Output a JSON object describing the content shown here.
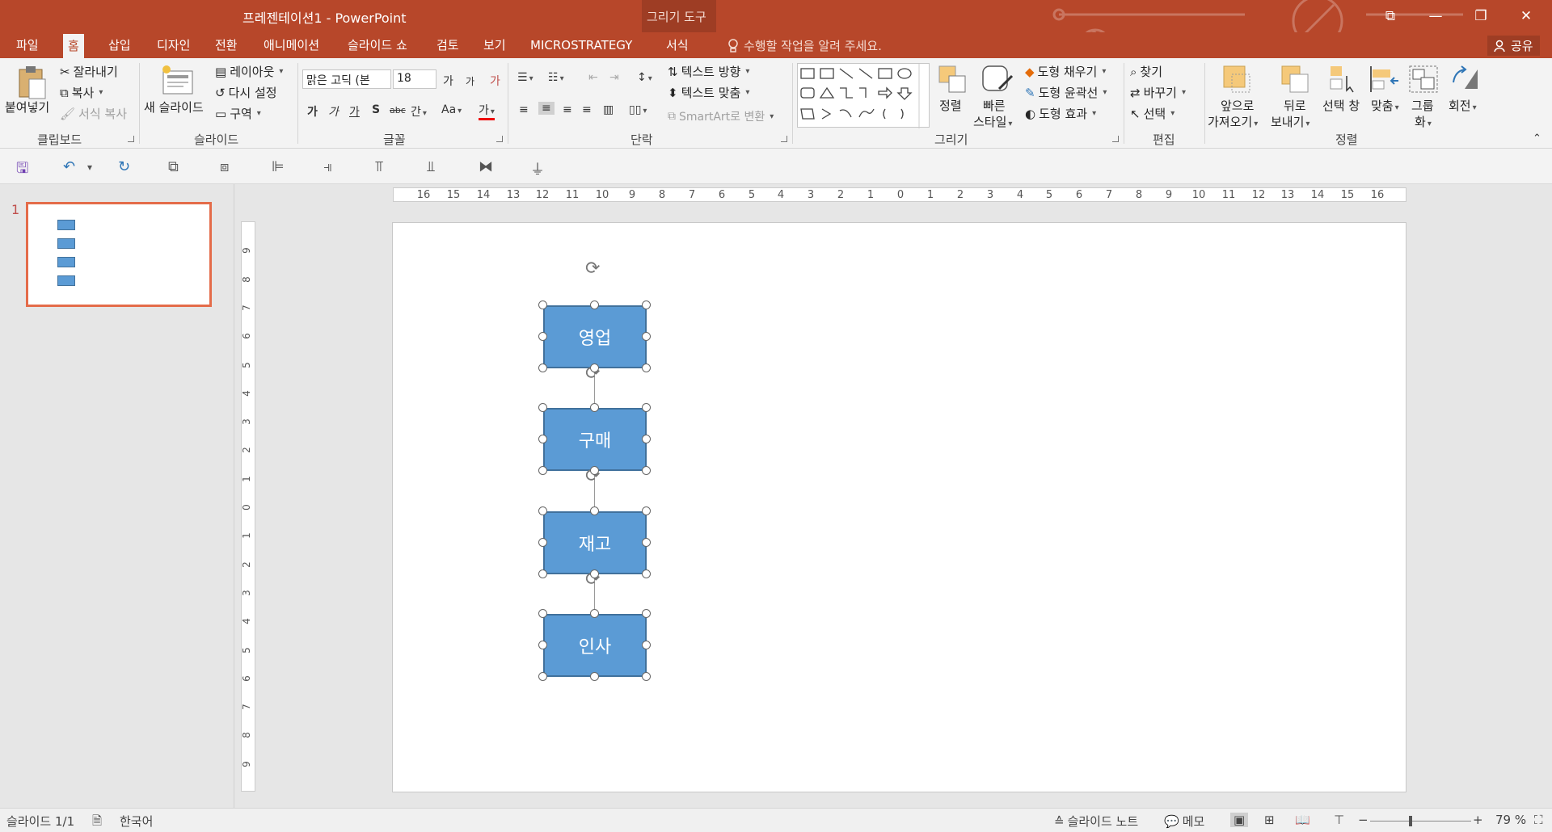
{
  "window": {
    "title": "프레젠테이션1 - PowerPoint",
    "context_group": "그리기 도구",
    "btn_ribbon_options": "⧉",
    "btn_minimize": "—",
    "btn_restore": "❐",
    "btn_close": "✕"
  },
  "tabs": [
    {
      "label": "파일",
      "active": false
    },
    {
      "label": "홈",
      "active": true
    },
    {
      "label": "삽입",
      "active": false
    },
    {
      "label": "디자인",
      "active": false
    },
    {
      "label": "전환",
      "active": false
    },
    {
      "label": "애니메이션",
      "active": false
    },
    {
      "label": "슬라이드 쇼",
      "active": false
    },
    {
      "label": "검토",
      "active": false
    },
    {
      "label": "보기",
      "active": false
    },
    {
      "label": "MICROSTRATEGY",
      "active": false
    },
    {
      "label": "서식",
      "active": false
    }
  ],
  "tell_me": "수행할 작업을 알려 주세요.",
  "share": "공유",
  "ribbon": {
    "clipboard": {
      "label": "클립보드",
      "paste": "붙여넣기",
      "cut": "잘라내기",
      "copy": "복사",
      "format_painter": "서식 복사"
    },
    "slides": {
      "label": "슬라이드",
      "new_slide": "새 슬라이드",
      "layout": "레이아웃",
      "reset": "다시 설정",
      "section": "구역"
    },
    "font": {
      "label": "글꼴",
      "font_name": "맑은 고딕 (본",
      "font_size": "18",
      "grow": "가",
      "shrink": "가",
      "clear": "가",
      "bold": "가",
      "italic": "가",
      "underline": "가",
      "shadow": "S",
      "strike": "abc",
      "spacing": "간",
      "case": "Aa",
      "color": "가"
    },
    "paragraph": {
      "label": "단락",
      "text_direction": "텍스트 방향",
      "align_text": "텍스트 맞춤",
      "smartart": "SmartArt로 변환"
    },
    "drawing": {
      "label": "그리기",
      "arrange": "정렬",
      "quick_styles_1": "빠른",
      "quick_styles_2": "스타일",
      "shape_fill": "도형 채우기",
      "shape_outline": "도형 윤곽선",
      "shape_effects": "도형 효과"
    },
    "editing": {
      "label": "편집",
      "find": "찾기",
      "replace": "바꾸기",
      "select": "선택"
    },
    "arrange": {
      "label": "정렬",
      "bring_forward_1": "앞으로",
      "bring_forward_2": "가져오기",
      "send_backward_1": "뒤로",
      "send_backward_2": "보내기",
      "selection_pane": "선택 창",
      "align": "맞춤",
      "group_1": "그룹",
      "group_2": "화",
      "rotate": "회전"
    }
  },
  "slide_number": "1",
  "slide_shapes": [
    {
      "label": "영업"
    },
    {
      "label": "구매"
    },
    {
      "label": "재고"
    },
    {
      "label": "인사"
    }
  ],
  "thumb_shapes": [
    "영업",
    "구매",
    "재고",
    "인사"
  ],
  "ruler": {
    "horizontal": [
      "16",
      "15",
      "14",
      "13",
      "12",
      "11",
      "10",
      "9",
      "8",
      "7",
      "6",
      "5",
      "4",
      "3",
      "2",
      "1",
      "0",
      "1",
      "2",
      "3",
      "4",
      "5",
      "6",
      "7",
      "8",
      "9",
      "10",
      "11",
      "12",
      "13",
      "14",
      "15",
      "16"
    ],
    "vertical": [
      "9",
      "8",
      "7",
      "6",
      "5",
      "4",
      "3",
      "2",
      "1",
      "0",
      "1",
      "2",
      "3",
      "4",
      "5",
      "6",
      "7",
      "8",
      "9"
    ]
  },
  "status": {
    "slide_info": "슬라이드 1/1",
    "language": "한국어",
    "notes": "슬라이드 노트",
    "comments": "메모",
    "zoom_minus": "−",
    "zoom_plus": "+",
    "zoom": "79 %",
    "zoom_fraction": 0.4
  }
}
